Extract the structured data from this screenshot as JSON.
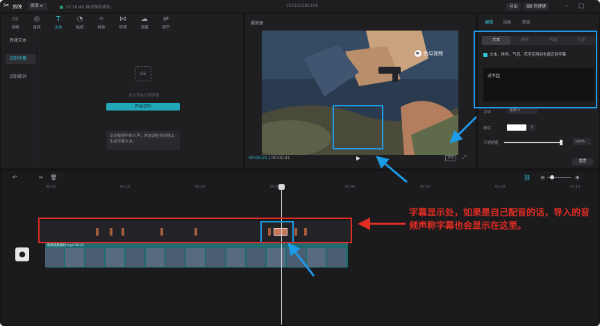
{
  "titlebar": {
    "app_name": "剪映",
    "menu_label": "菜单",
    "autosave": "15:18:46 自动保存成功",
    "doc_title": "202102081108",
    "export_label": "导出",
    "shortcut_label": "快捷键"
  },
  "media_toolbar": {
    "tools": [
      {
        "icon": "video-icon",
        "label": "视频"
      },
      {
        "icon": "audio-icon",
        "label": "音频"
      },
      {
        "icon": "text-icon",
        "label": "文本"
      },
      {
        "icon": "sticker-icon",
        "label": "贴纸"
      },
      {
        "icon": "effects-icon",
        "label": "特效"
      },
      {
        "icon": "transition-icon",
        "label": "转场"
      },
      {
        "icon": "filter-icon",
        "label": "滤镜"
      },
      {
        "icon": "adjust-icon",
        "label": "调节"
      }
    ],
    "active_index": 2
  },
  "text_sidebar": {
    "items": [
      "新建文本",
      "识别字幕",
      "识别歌词"
    ],
    "active_index": 1
  },
  "recognize": {
    "placeholder_icon": "AE",
    "hint": "点击开始识别字幕",
    "button_label": "开始识别",
    "description": "识别视频中的人声，并自动在时间线上生成字幕文本。"
  },
  "player": {
    "title": "播放器",
    "current_time": "00:00:21",
    "total_time": "00:00:41",
    "watermark": "西瓜视频",
    "ratio_label": "原始"
  },
  "inspector": {
    "tabs": [
      "编辑",
      "动画",
      "朗读"
    ],
    "active_tab": 0,
    "sub_tabs": [
      "文本",
      "排列",
      "气泡",
      "花字"
    ],
    "active_sub_tab": 0,
    "apply_all_label": "文本、排列、气泡、花字应用到全部识别字幕",
    "subtitle_text": "对不起",
    "font_label": "字体",
    "font_value": "系统",
    "color_label": "颜色",
    "text_color": "#ffffff",
    "opacity_label": "不透明度",
    "opacity_value": "100%",
    "opacity_level": 1.0,
    "reset_label": "重置"
  },
  "timeline": {
    "ruler_labels": [
      "00:00",
      "00:10",
      "00:20",
      "00:30",
      "00:40",
      "00:50",
      "01:00",
      "01:10"
    ],
    "video_clip_label": "假期视频素材.mp4  00:41",
    "accent_color": "#31c3d6"
  },
  "annotation": {
    "text": "字幕显示处，如果是自己配音的话，导入的音频声称字幕也会显示在这里。",
    "box_color_red": "#e02c22",
    "box_color_blue": "#1e9be6"
  }
}
